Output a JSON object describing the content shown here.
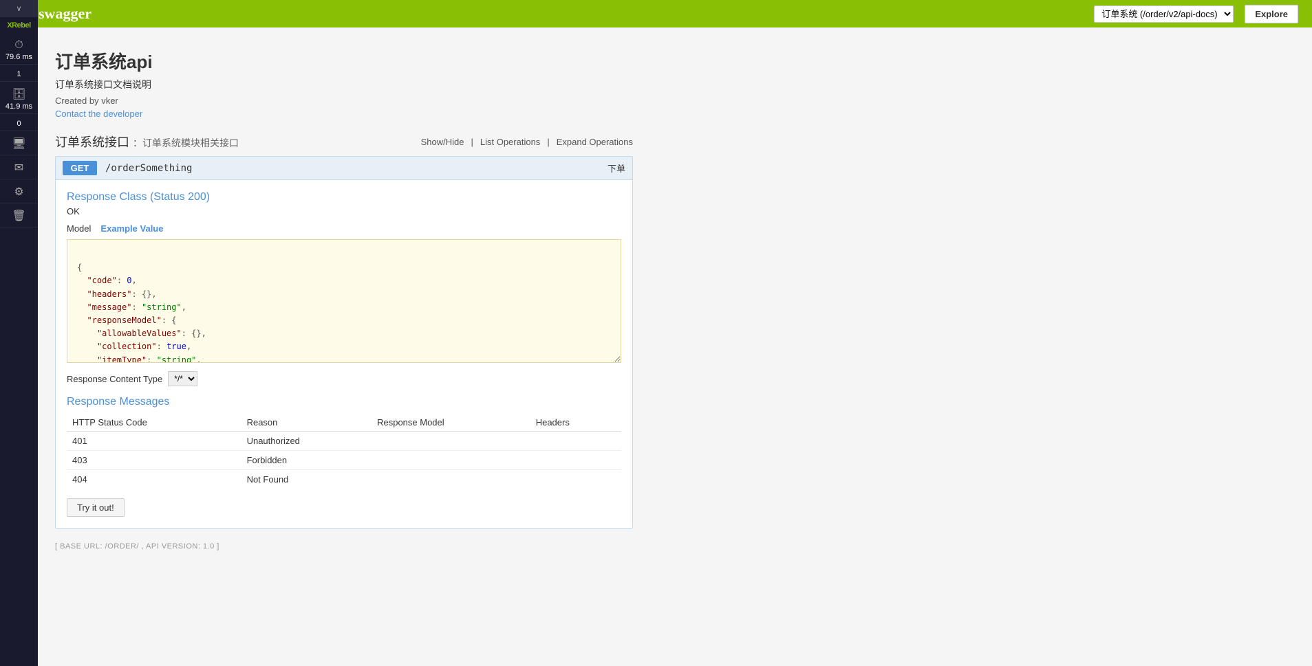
{
  "topNav": {
    "logoText": "swagger",
    "urlSelectValue": "订单系统 (/order/v2/api-docs)",
    "exploreLabel": "Explore"
  },
  "api": {
    "title": "订单系统api",
    "description": "订单系统接口文档说明",
    "createdBy": "Created by vker",
    "contactLink": "Contact the developer"
  },
  "apiGroup": {
    "title": "订单系统接口",
    "subtitle": "：订单系统模块相关接口",
    "actions": {
      "showHide": "Show/Hide",
      "listOperations": "List Operations",
      "expandOperations": "Expand Operations"
    }
  },
  "operation": {
    "method": "GET",
    "path": "/orderSomething",
    "summary": "下单",
    "responseClass": "Response Class (Status 200)",
    "responseOk": "OK",
    "modelTab": "Model",
    "exampleTab": "Example Value",
    "jsonContent": "{\n  \"code\": 0,\n  \"headers\": {},\n  \"message\": \"string\",\n  \"responseModel\": {\n    \"allowableValues\": {},\n    \"collection\": true,\n    \"itemType\": \"string\",\n    \"map\": true,\n    \"type\": \"string\"\n  }",
    "responseContentTypeLabel": "Response Content Type",
    "responseContentTypeValue": "*/*",
    "responseMessagesTitle": "Response Messages",
    "tableHeaders": [
      "HTTP Status Code",
      "Reason",
      "Response Model",
      "Headers"
    ],
    "tableRows": [
      {
        "status": "401",
        "reason": "Unauthorized",
        "model": "",
        "headers": ""
      },
      {
        "status": "403",
        "reason": "Forbidden",
        "model": "",
        "headers": ""
      },
      {
        "status": "404",
        "reason": "Not Found",
        "model": "",
        "headers": ""
      }
    ],
    "tryItOutLabel": "Try it out!"
  },
  "footer": {
    "baseUrl": "[ BASE URL: /order/ , API VERSION: 1.0 ]"
  },
  "xrebel": {
    "collapseIcon": "∨",
    "brand": "XRebel",
    "items": [
      {
        "icon": "⏱",
        "value": "79.6 ms",
        "label": ""
      },
      {
        "icon": "1",
        "value": "",
        "label": ""
      },
      {
        "icon": "🗄",
        "value": "41.9 ms",
        "label": ""
      },
      {
        "icon": "0",
        "value": "",
        "label": ""
      },
      {
        "icon": "🖥",
        "value": "",
        "label": ""
      },
      {
        "icon": "✉",
        "value": "",
        "label": ""
      },
      {
        "icon": "⚙",
        "value": "",
        "label": ""
      },
      {
        "icon": "🗑",
        "value": "",
        "label": ""
      }
    ]
  }
}
